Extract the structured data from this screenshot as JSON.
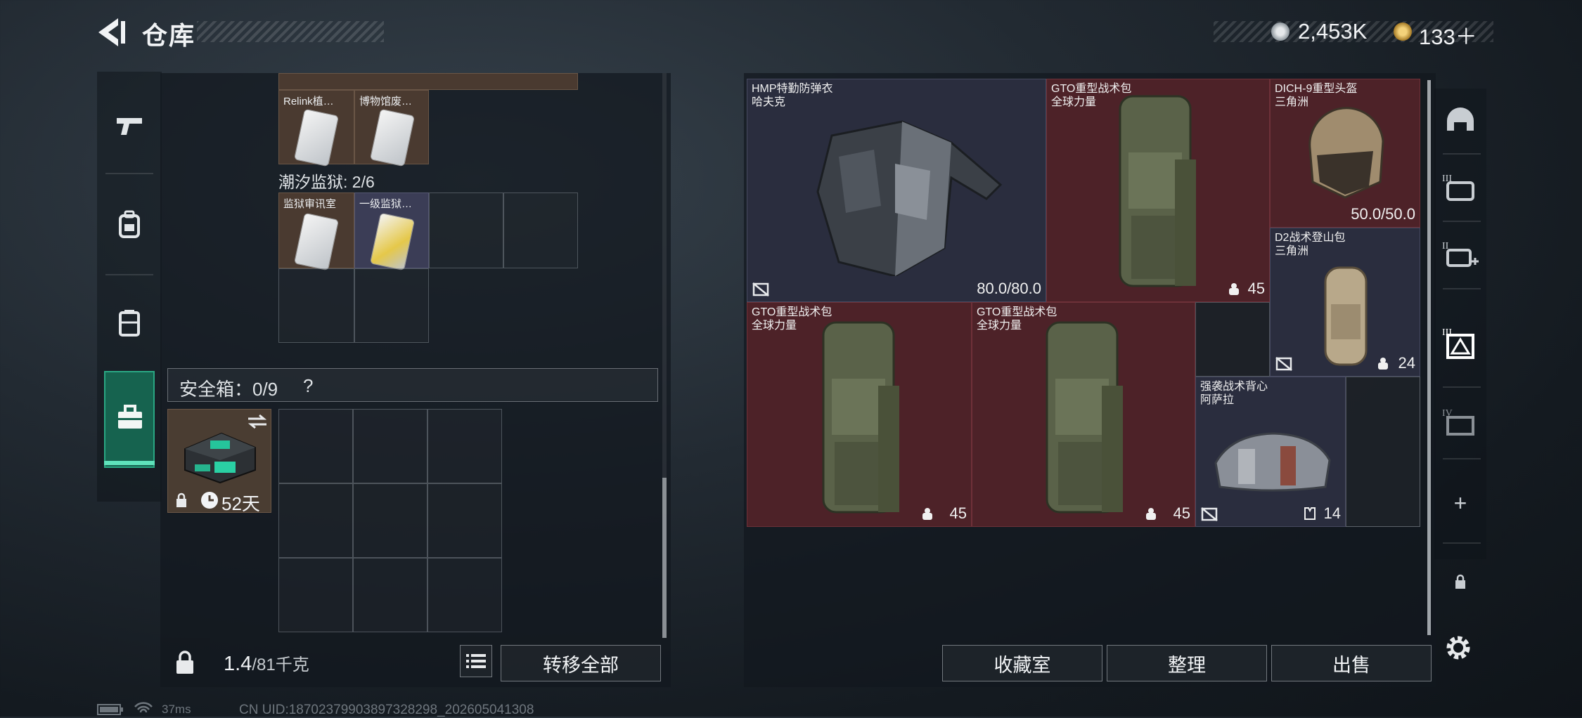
{
  "header": {
    "title": "仓库",
    "currency": {
      "silver": "2,453K",
      "gold": "133＋"
    }
  },
  "left_nav": {
    "items": [
      "pistol-icon",
      "backpack-icon",
      "vest-icon",
      "toolbox-icon"
    ]
  },
  "left_panel": {
    "top_items": [
      {
        "label": "Relink植…"
      },
      {
        "label": "博物馆废…"
      }
    ],
    "prison": {
      "label": "潮汐监狱: 2/6",
      "items": [
        {
          "label": "监狱审讯室"
        },
        {
          "label": "一级监狱…"
        }
      ]
    },
    "safe_box": {
      "label": "安全箱：0/9",
      "help": "?",
      "timer": "52天"
    },
    "weight": {
      "current": "1.4",
      "max": "/81千克"
    },
    "transfer_all": "转移全部"
  },
  "right_panel": {
    "items": [
      {
        "name": "HMP特勤防弹衣",
        "brand": "哈夫克",
        "value": "80.0/80.0"
      },
      {
        "name": "GTO重型战术包",
        "brand": "全球力量",
        "value": "45"
      },
      {
        "name": "DICH-9重型头盔",
        "brand": "三角洲",
        "value": "50.0/50.0"
      },
      {
        "name": "D2战术登山包",
        "brand": "三角洲",
        "value": "24"
      },
      {
        "name": "GTO重型战术包",
        "brand": "全球力量",
        "value": "45"
      },
      {
        "name": "GTO重型战术包",
        "brand": "全球力量",
        "value": "45"
      },
      {
        "name": "强袭战术背心",
        "brand": "阿萨拉",
        "value": "14"
      }
    ],
    "buttons": {
      "collection": "收藏室",
      "organize": "整理",
      "sell": "出售"
    },
    "side_tabs": [
      "helmet-icon",
      "III",
      "II",
      "III",
      "IV",
      "+"
    ]
  },
  "status": {
    "ping": "37ms",
    "uid": "CN UID:187023799038973282​98_202605041308"
  },
  "colors": {
    "accent": "#2aa783",
    "red_item": "#4d2228",
    "dark_item": "#2a2d3e"
  }
}
